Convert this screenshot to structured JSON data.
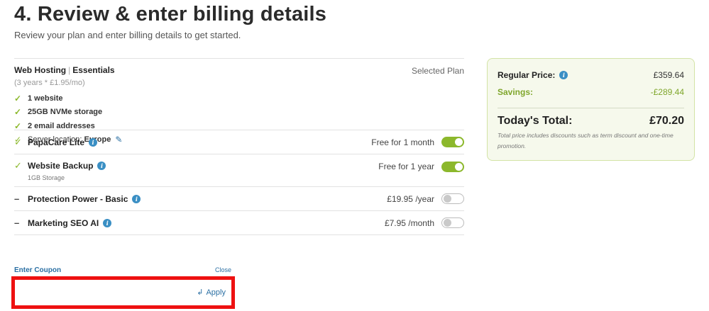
{
  "header": {
    "title": "4. Review & enter billing details",
    "subtitle": "Review your plan and enter billing details to get started."
  },
  "plan": {
    "product": "Web Hosting",
    "separator": "|",
    "tier": "Essentials",
    "terms": "(3 years * £1.95/mo)",
    "selected_label": "Selected Plan",
    "features": [
      "1 website",
      "25GB NVMe storage",
      "2 email addresses"
    ],
    "server_location_label": "Server location:",
    "server_location_value": "Europe"
  },
  "addons": [
    {
      "name": "PapaCare Lite",
      "price": "Free for 1 month",
      "enabled": true,
      "sub": ""
    },
    {
      "name": "Website Backup",
      "price": "Free for 1 year",
      "enabled": true,
      "sub": "1GB Storage"
    },
    {
      "name": "Protection Power - Basic",
      "price": "£19.95 /year",
      "enabled": false,
      "sub": ""
    },
    {
      "name": "Marketing SEO AI",
      "price": "£7.95 /month",
      "enabled": false,
      "sub": ""
    }
  ],
  "coupon": {
    "label": "Enter Coupon",
    "close": "Close",
    "value": "",
    "apply": "Apply"
  },
  "summary": {
    "regular_label": "Regular Price:",
    "regular_value": "£359.64",
    "savings_label": "Savings:",
    "savings_value": "-£289.44",
    "total_label": "Today's Total:",
    "total_value": "£70.20",
    "note": "Total price includes discounts such as term discount and one-time promotion."
  },
  "colors": {
    "accent_green": "#8cb82c",
    "link_blue": "#2a6fa3",
    "highlight_red": "#ee1111"
  },
  "icons": {
    "check": "check-icon",
    "dash": "dash-icon",
    "info": "info-icon",
    "edit": "pencil-icon",
    "apply": "return-arrow-icon"
  }
}
